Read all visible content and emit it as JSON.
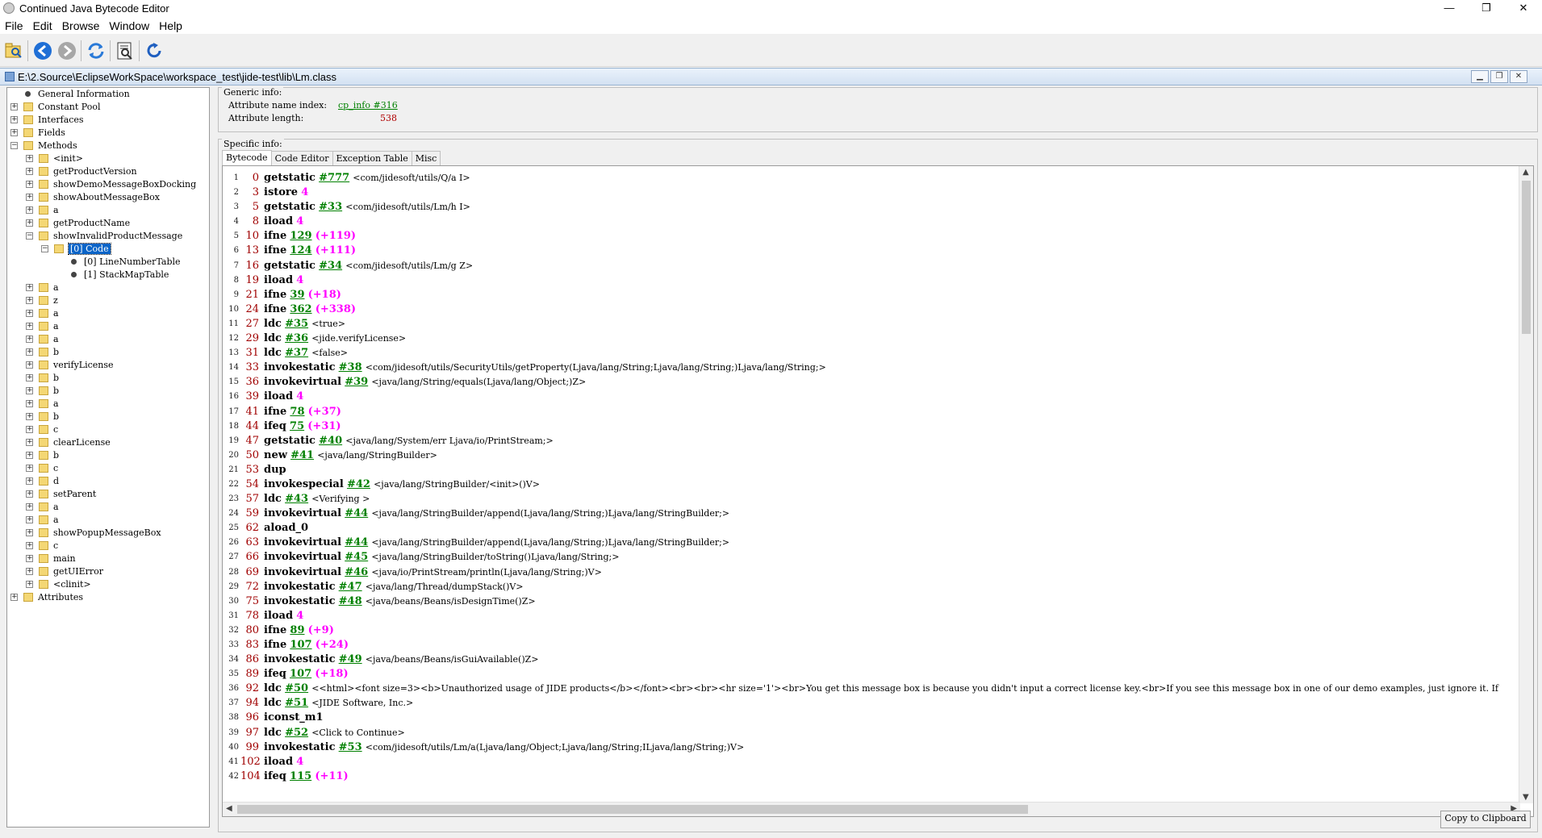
{
  "window": {
    "title": "Continued Java Bytecode Editor",
    "minimize_icon": "—",
    "restore_icon": "❐",
    "close_icon": "✕"
  },
  "menu": [
    "File",
    "Edit",
    "Browse",
    "Window",
    "Help"
  ],
  "toolbar": {
    "icons": [
      "open-icon",
      "back-icon",
      "forward-icon",
      "refresh-icon",
      "inspect-icon",
      "reload-icon"
    ]
  },
  "path": "E:\\2.Source\\EclipseWorkSpace\\workspace_test\\jide-test\\lib\\Lm.class",
  "tree": [
    {
      "label": "General Information",
      "type": "leaf",
      "level": 0
    },
    {
      "label": "Constant Pool",
      "type": "folder",
      "level": 0,
      "toggle": "+"
    },
    {
      "label": "Interfaces",
      "type": "folder",
      "level": 0,
      "toggle": "+"
    },
    {
      "label": "Fields",
      "type": "folder",
      "level": 0,
      "toggle": "+"
    },
    {
      "label": "Methods",
      "type": "folder",
      "level": 0,
      "toggle": "−"
    },
    {
      "label": "<init>",
      "type": "folder",
      "level": 1,
      "toggle": "+"
    },
    {
      "label": "getProductVersion",
      "type": "folder",
      "level": 1,
      "toggle": "+"
    },
    {
      "label": "showDemoMessageBoxDocking",
      "type": "folder",
      "level": 1,
      "toggle": "+"
    },
    {
      "label": "showAboutMessageBox",
      "type": "folder",
      "level": 1,
      "toggle": "+"
    },
    {
      "label": "a",
      "type": "folder",
      "level": 1,
      "toggle": "+"
    },
    {
      "label": "getProductName",
      "type": "folder",
      "level": 1,
      "toggle": "+"
    },
    {
      "label": "showInvalidProductMessage",
      "type": "folder",
      "level": 1,
      "toggle": "−"
    },
    {
      "label": "[0] Code",
      "type": "folder",
      "level": 2,
      "toggle": "−",
      "selected": true
    },
    {
      "label": "[0] LineNumberTable",
      "type": "leaf",
      "level": 3
    },
    {
      "label": "[1] StackMapTable",
      "type": "leaf",
      "level": 3
    },
    {
      "label": "a",
      "type": "folder",
      "level": 1,
      "toggle": "+"
    },
    {
      "label": "z",
      "type": "folder",
      "level": 1,
      "toggle": "+"
    },
    {
      "label": "a",
      "type": "folder",
      "level": 1,
      "toggle": "+"
    },
    {
      "label": "a",
      "type": "folder",
      "level": 1,
      "toggle": "+"
    },
    {
      "label": "a",
      "type": "folder",
      "level": 1,
      "toggle": "+"
    },
    {
      "label": "b",
      "type": "folder",
      "level": 1,
      "toggle": "+"
    },
    {
      "label": "verifyLicense",
      "type": "folder",
      "level": 1,
      "toggle": "+"
    },
    {
      "label": "b",
      "type": "folder",
      "level": 1,
      "toggle": "+"
    },
    {
      "label": "b",
      "type": "folder",
      "level": 1,
      "toggle": "+"
    },
    {
      "label": "a",
      "type": "folder",
      "level": 1,
      "toggle": "+"
    },
    {
      "label": "b",
      "type": "folder",
      "level": 1,
      "toggle": "+"
    },
    {
      "label": "c",
      "type": "folder",
      "level": 1,
      "toggle": "+"
    },
    {
      "label": "clearLicense",
      "type": "folder",
      "level": 1,
      "toggle": "+"
    },
    {
      "label": "b",
      "type": "folder",
      "level": 1,
      "toggle": "+"
    },
    {
      "label": "c",
      "type": "folder",
      "level": 1,
      "toggle": "+"
    },
    {
      "label": "d",
      "type": "folder",
      "level": 1,
      "toggle": "+"
    },
    {
      "label": "setParent",
      "type": "folder",
      "level": 1,
      "toggle": "+"
    },
    {
      "label": "a",
      "type": "folder",
      "level": 1,
      "toggle": "+"
    },
    {
      "label": "a",
      "type": "folder",
      "level": 1,
      "toggle": "+"
    },
    {
      "label": "showPopupMessageBox",
      "type": "folder",
      "level": 1,
      "toggle": "+"
    },
    {
      "label": "c",
      "type": "folder",
      "level": 1,
      "toggle": "+"
    },
    {
      "label": "main",
      "type": "folder",
      "level": 1,
      "toggle": "+"
    },
    {
      "label": "getUIError",
      "type": "folder",
      "level": 1,
      "toggle": "+"
    },
    {
      "label": "<clinit>",
      "type": "folder",
      "level": 1,
      "toggle": "+"
    },
    {
      "label": "Attributes",
      "type": "folder",
      "level": 0,
      "toggle": "+"
    }
  ],
  "generic": {
    "legend": "Generic info:",
    "name_index_label": "Attribute name index:",
    "name_index_value": "cp_info #316",
    "length_label": "Attribute length:",
    "length_value": "538"
  },
  "specific": {
    "legend": "Specific info:",
    "tabs": [
      "Bytecode",
      "Code Editor",
      "Exception Table",
      "Misc"
    ],
    "active_tab": 0,
    "copy_button": "Copy to Clipboard"
  },
  "code": [
    {
      "ln": "1",
      "off": "0",
      "op": "getstatic",
      "ref": "#777",
      "lit": "",
      "cmt": "<com/jidesoft/utils/Q/a I>"
    },
    {
      "ln": "2",
      "off": "3",
      "op": "istore",
      "ref": "",
      "lit": "4",
      "cmt": ""
    },
    {
      "ln": "3",
      "off": "5",
      "op": "getstatic",
      "ref": "#33",
      "lit": "",
      "cmt": "<com/jidesoft/utils/Lm/h I>"
    },
    {
      "ln": "4",
      "off": "8",
      "op": "iload",
      "ref": "",
      "lit": "4",
      "cmt": ""
    },
    {
      "ln": "5",
      "off": "10",
      "op": "ifne",
      "ref": "129",
      "lit": "(+119)",
      "cmt": ""
    },
    {
      "ln": "6",
      "off": "13",
      "op": "ifne",
      "ref": "124",
      "lit": "(+111)",
      "cmt": ""
    },
    {
      "ln": "7",
      "off": "16",
      "op": "getstatic",
      "ref": "#34",
      "lit": "",
      "cmt": "<com/jidesoft/utils/Lm/g Z>"
    },
    {
      "ln": "8",
      "off": "19",
      "op": "iload",
      "ref": "",
      "lit": "4",
      "cmt": ""
    },
    {
      "ln": "9",
      "off": "21",
      "op": "ifne",
      "ref": "39",
      "lit": "(+18)",
      "cmt": ""
    },
    {
      "ln": "10",
      "off": "24",
      "op": "ifne",
      "ref": "362",
      "lit": "(+338)",
      "cmt": ""
    },
    {
      "ln": "11",
      "off": "27",
      "op": "ldc",
      "ref": "#35",
      "lit": "",
      "cmt": "<true>"
    },
    {
      "ln": "12",
      "off": "29",
      "op": "ldc",
      "ref": "#36",
      "lit": "",
      "cmt": "<jide.verifyLicense>"
    },
    {
      "ln": "13",
      "off": "31",
      "op": "ldc",
      "ref": "#37",
      "lit": "",
      "cmt": "<false>"
    },
    {
      "ln": "14",
      "off": "33",
      "op": "invokestatic",
      "ref": "#38",
      "lit": "",
      "cmt": "<com/jidesoft/utils/SecurityUtils/getProperty(Ljava/lang/String;Ljava/lang/String;)Ljava/lang/String;>"
    },
    {
      "ln": "15",
      "off": "36",
      "op": "invokevirtual",
      "ref": "#39",
      "lit": "",
      "cmt": "<java/lang/String/equals(Ljava/lang/Object;)Z>"
    },
    {
      "ln": "16",
      "off": "39",
      "op": "iload",
      "ref": "",
      "lit": "4",
      "cmt": ""
    },
    {
      "ln": "17",
      "off": "41",
      "op": "ifne",
      "ref": "78",
      "lit": "(+37)",
      "cmt": ""
    },
    {
      "ln": "18",
      "off": "44",
      "op": "ifeq",
      "ref": "75",
      "lit": "(+31)",
      "cmt": ""
    },
    {
      "ln": "19",
      "off": "47",
      "op": "getstatic",
      "ref": "#40",
      "lit": "",
      "cmt": "<java/lang/System/err Ljava/io/PrintStream;>"
    },
    {
      "ln": "20",
      "off": "50",
      "op": "new",
      "ref": "#41",
      "lit": "",
      "cmt": "<java/lang/StringBuilder>"
    },
    {
      "ln": "21",
      "off": "53",
      "op": "dup",
      "ref": "",
      "lit": "",
      "cmt": ""
    },
    {
      "ln": "22",
      "off": "54",
      "op": "invokespecial",
      "ref": "#42",
      "lit": "",
      "cmt": "<java/lang/StringBuilder/<init>()V>"
    },
    {
      "ln": "23",
      "off": "57",
      "op": "ldc",
      "ref": "#43",
      "lit": "",
      "cmt": "<Verifying >"
    },
    {
      "ln": "24",
      "off": "59",
      "op": "invokevirtual",
      "ref": "#44",
      "lit": "",
      "cmt": "<java/lang/StringBuilder/append(Ljava/lang/String;)Ljava/lang/StringBuilder;>"
    },
    {
      "ln": "25",
      "off": "62",
      "op": "aload_0",
      "ref": "",
      "lit": "",
      "cmt": ""
    },
    {
      "ln": "26",
      "off": "63",
      "op": "invokevirtual",
      "ref": "#44",
      "lit": "",
      "cmt": "<java/lang/StringBuilder/append(Ljava/lang/String;)Ljava/lang/StringBuilder;>"
    },
    {
      "ln": "27",
      "off": "66",
      "op": "invokevirtual",
      "ref": "#45",
      "lit": "",
      "cmt": "<java/lang/StringBuilder/toString()Ljava/lang/String;>"
    },
    {
      "ln": "28",
      "off": "69",
      "op": "invokevirtual",
      "ref": "#46",
      "lit": "",
      "cmt": "<java/io/PrintStream/println(Ljava/lang/String;)V>"
    },
    {
      "ln": "29",
      "off": "72",
      "op": "invokestatic",
      "ref": "#47",
      "lit": "",
      "cmt": "<java/lang/Thread/dumpStack()V>"
    },
    {
      "ln": "30",
      "off": "75",
      "op": "invokestatic",
      "ref": "#48",
      "lit": "",
      "cmt": "<java/beans/Beans/isDesignTime()Z>"
    },
    {
      "ln": "31",
      "off": "78",
      "op": "iload",
      "ref": "",
      "lit": "4",
      "cmt": ""
    },
    {
      "ln": "32",
      "off": "80",
      "op": "ifne",
      "ref": "89",
      "lit": "(+9)",
      "cmt": ""
    },
    {
      "ln": "33",
      "off": "83",
      "op": "ifne",
      "ref": "107",
      "lit": "(+24)",
      "cmt": ""
    },
    {
      "ln": "34",
      "off": "86",
      "op": "invokestatic",
      "ref": "#49",
      "lit": "",
      "cmt": "<java/beans/Beans/isGuiAvailable()Z>"
    },
    {
      "ln": "35",
      "off": "89",
      "op": "ifeq",
      "ref": "107",
      "lit": "(+18)",
      "cmt": ""
    },
    {
      "ln": "36",
      "off": "92",
      "op": "ldc",
      "ref": "#50",
      "lit": "",
      "cmt": "<<html><font size=3><b>Unauthorized usage of JIDE products</b></font><br><br><hr size='1'><br>You get this message box is because you didn't input a correct license key.<br>If you see this message box in one of our demo examples, just ignore it. If"
    },
    {
      "ln": "37",
      "off": "94",
      "op": "ldc",
      "ref": "#51",
      "lit": "",
      "cmt": "<JIDE Software, Inc.>"
    },
    {
      "ln": "38",
      "off": "96",
      "op": "iconst_m1",
      "ref": "",
      "lit": "",
      "cmt": ""
    },
    {
      "ln": "39",
      "off": "97",
      "op": "ldc",
      "ref": "#52",
      "lit": "",
      "cmt": "<Click to Continue>"
    },
    {
      "ln": "40",
      "off": "99",
      "op": "invokestatic",
      "ref": "#53",
      "lit": "",
      "cmt": "<com/jidesoft/utils/Lm/a(Ljava/lang/Object;Ljava/lang/String;ILjava/lang/String;)V>"
    },
    {
      "ln": "41",
      "off": "102",
      "op": "iload",
      "ref": "",
      "lit": "4",
      "cmt": ""
    },
    {
      "ln": "42",
      "off": "104",
      "op": "ifeq",
      "ref": "115",
      "lit": "(+11)",
      "cmt": ""
    }
  ]
}
